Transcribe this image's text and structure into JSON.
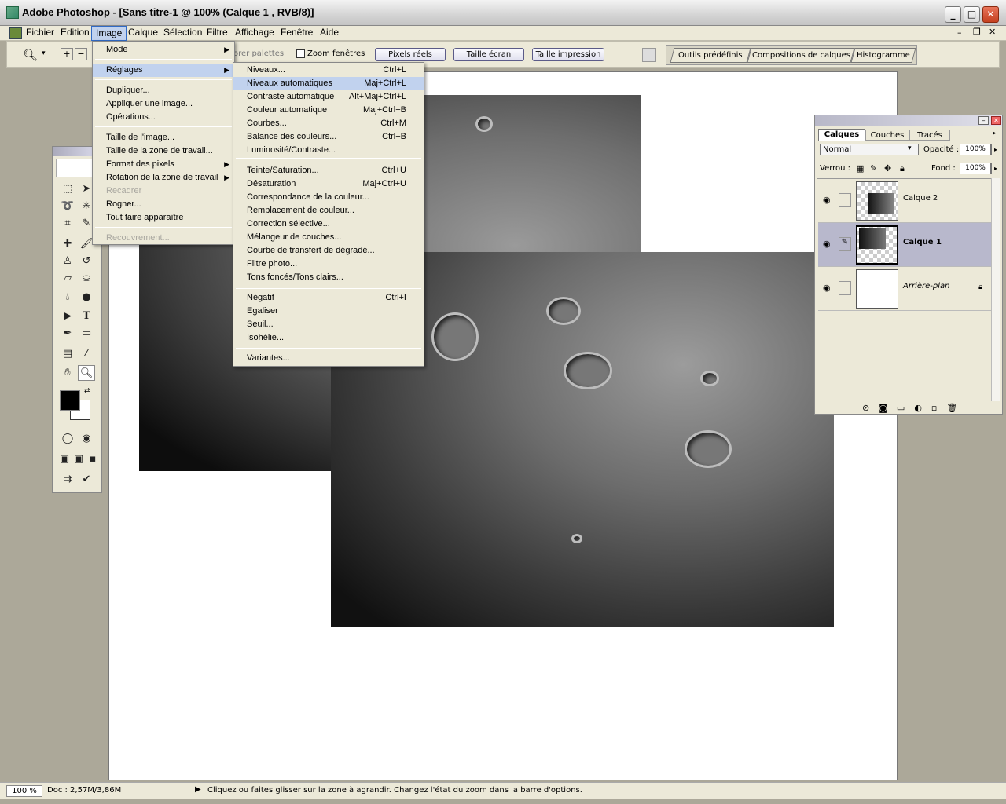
{
  "window": {
    "title": "Adobe Photoshop - [Sans titre-1 @ 100% (Calque 1 , RVB/8)]"
  },
  "menubar": [
    "Fichier",
    "Edition",
    "Image",
    "Calque",
    "Sélection",
    "Filtre",
    "Affichage",
    "Fenêtre",
    "Aide"
  ],
  "options": {
    "palettes_label": "orer palettes",
    "zoom_windows_label": "Zoom fenêtres",
    "btn_actual_pixels": "Pixels réels",
    "btn_fit_screen": "Taille écran",
    "btn_print_size": "Taille impression",
    "tabs": [
      "Outils prédéfinis",
      "Compositions de calques",
      "Histogramme"
    ]
  },
  "image_menu": {
    "items": [
      {
        "label": "Mode",
        "submenu": true
      },
      {
        "label": "Réglages",
        "submenu": true,
        "selected": true
      },
      {
        "label": "Dupliquer..."
      },
      {
        "label": "Appliquer une image..."
      },
      {
        "label": "Opérations..."
      },
      {
        "label": "Taille de l'image..."
      },
      {
        "label": "Taille de la zone de travail..."
      },
      {
        "label": "Format des pixels",
        "submenu": true
      },
      {
        "label": "Rotation de la zone de travail",
        "submenu": true
      },
      {
        "label": "Recadrer",
        "disabled": true
      },
      {
        "label": "Rogner..."
      },
      {
        "label": "Tout faire apparaître"
      },
      {
        "label": "Recouvrement...",
        "disabled": true
      }
    ]
  },
  "adjust_menu": {
    "items": [
      {
        "label": "Niveaux...",
        "shortcut": "Ctrl+L"
      },
      {
        "label": "Niveaux automatiques",
        "shortcut": "Maj+Ctrl+L",
        "selected": true
      },
      {
        "label": "Contraste automatique",
        "shortcut": "Alt+Maj+Ctrl+L"
      },
      {
        "label": "Couleur automatique",
        "shortcut": "Maj+Ctrl+B"
      },
      {
        "label": "Courbes...",
        "shortcut": "Ctrl+M"
      },
      {
        "label": "Balance des couleurs...",
        "shortcut": "Ctrl+B"
      },
      {
        "label": "Luminosité/Contraste...",
        "shortcut": ""
      },
      {
        "label": "Teinte/Saturation...",
        "shortcut": "Ctrl+U"
      },
      {
        "label": "Désaturation",
        "shortcut": "Maj+Ctrl+U"
      },
      {
        "label": "Correspondance de la couleur...",
        "shortcut": ""
      },
      {
        "label": "Remplacement de couleur...",
        "shortcut": ""
      },
      {
        "label": "Correction sélective...",
        "shortcut": ""
      },
      {
        "label": "Mélangeur de couches...",
        "shortcut": ""
      },
      {
        "label": "Courbe de transfert de dégradé...",
        "shortcut": ""
      },
      {
        "label": "Filtre photo...",
        "shortcut": ""
      },
      {
        "label": "Tons foncés/Tons clairs...",
        "shortcut": ""
      },
      {
        "label": "Négatif",
        "shortcut": "Ctrl+I"
      },
      {
        "label": "Egaliser",
        "shortcut": ""
      },
      {
        "label": "Seuil...",
        "shortcut": ""
      },
      {
        "label": "Isohélie...",
        "shortcut": ""
      },
      {
        "label": "Variantes...",
        "shortcut": ""
      }
    ]
  },
  "layers_panel": {
    "tabs": [
      "Calques",
      "Couches",
      "Tracés"
    ],
    "blend_mode": "Normal",
    "opacity_label": "Opacité :",
    "opacity_value": "100%",
    "lock_label": "Verrou :",
    "fill_label": "Fond :",
    "fill_value": "100%",
    "layers": [
      {
        "name": "Calque 2"
      },
      {
        "name": "Calque 1",
        "selected": true
      },
      {
        "name": "Arrière-plan",
        "locked": true
      }
    ]
  },
  "status": {
    "zoom": "100 %",
    "doc": "Doc : 2,57M/3,86M",
    "hint": "Cliquez ou faites glisser sur la zone à agrandir. Changez l'état du zoom dans la barre d'options."
  }
}
